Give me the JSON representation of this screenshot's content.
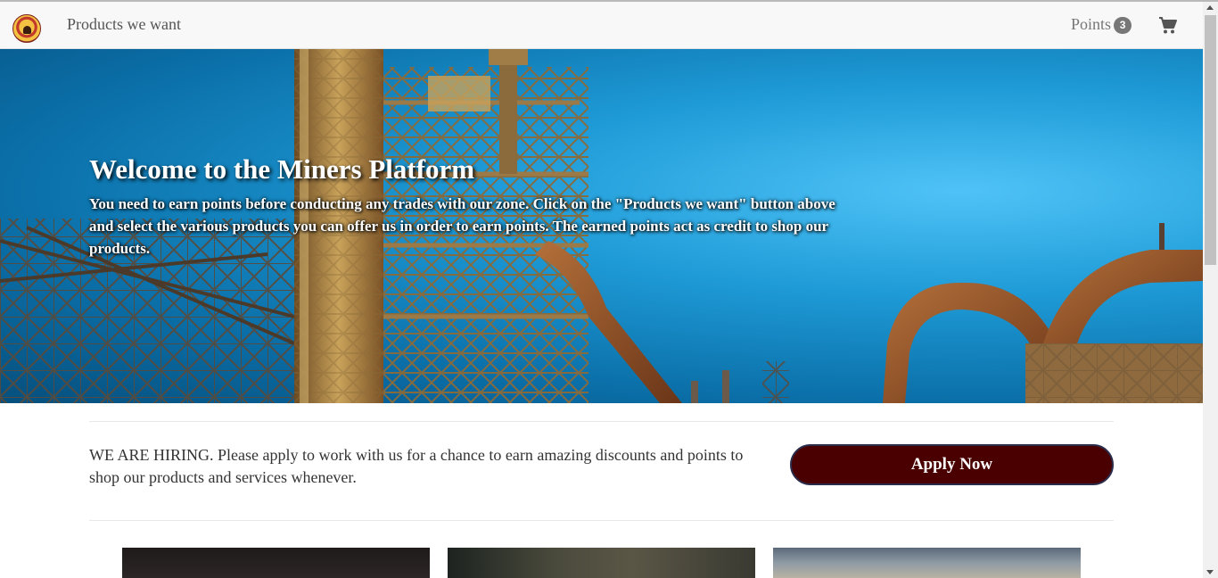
{
  "navbar": {
    "products_link": "Products we want",
    "points_label": "Points",
    "points_count": "3"
  },
  "hero": {
    "title": "Welcome to the Miners Platform",
    "text": "You need to earn points before conducting any trades with our zone. Click on the \"Products we want\" button above and select the various products you can offer us in order to earn points. The earned points act as credit to shop our products."
  },
  "hiring": {
    "text": "WE ARE HIRING. Please apply to work with us for a chance to earn amazing discounts and points to shop our products and services whenever.",
    "button_label": "Apply Now"
  },
  "colors": {
    "apply_button": "#4a0000",
    "navbar_bg": "#f8f8f8",
    "badge": "#777777"
  },
  "icons": {
    "logo": "miner-logo-icon",
    "cart": "shopping-cart-icon"
  }
}
